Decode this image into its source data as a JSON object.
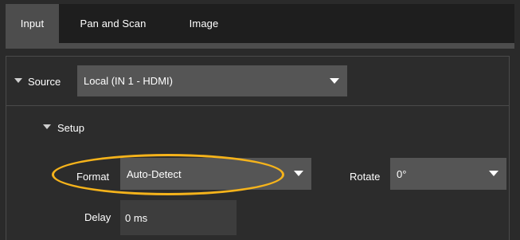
{
  "tabs": [
    {
      "label": "Input",
      "active": true
    },
    {
      "label": "Pan and Scan",
      "active": false
    },
    {
      "label": "Image",
      "active": false
    }
  ],
  "source": {
    "label": "Source",
    "value": "Local (IN 1 - HDMI)"
  },
  "setup": {
    "label": "Setup",
    "format": {
      "label": "Format",
      "value": "Auto-Detect"
    },
    "rotate": {
      "label": "Rotate",
      "value": "0°"
    },
    "delay": {
      "label": "Delay",
      "value": "0 ms"
    }
  },
  "colors": {
    "background": "#2a2a2a",
    "tab_active": "#4d4d4d",
    "dropdown": "#555555",
    "highlight_annotation": "#f5b31b"
  },
  "icons": [
    "expand-caret-icon",
    "dropdown-arrow-icon"
  ]
}
